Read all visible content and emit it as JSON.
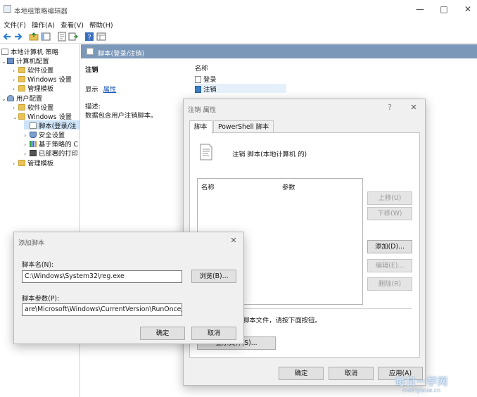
{
  "window": {
    "title": "本地组策略编辑器"
  },
  "menu": [
    "文件(F)",
    "操作(A)",
    "查看(V)",
    "帮助(H)"
  ],
  "tree": [
    {
      "label": "本地计算机 策略",
      "icon": "computer-policy-icon"
    },
    {
      "label": "计算机配置",
      "icon": "computer-icon"
    },
    {
      "label": "软件设置",
      "icon": "folder-icon"
    },
    {
      "label": "Windows 设置",
      "icon": "folder-icon"
    },
    {
      "label": "管理模板",
      "icon": "folder-icon"
    },
    {
      "label": "用户配置",
      "icon": "user-icon"
    },
    {
      "label": "软件设置",
      "icon": "folder-icon"
    },
    {
      "label": "Windows 设置",
      "icon": "folder-icon"
    },
    {
      "label": "脚本(登录/注",
      "icon": "script-icon"
    },
    {
      "label": "安全设置",
      "icon": "shield-icon"
    },
    {
      "label": "基于策略的 C",
      "icon": "chart-icon"
    },
    {
      "label": "已部署的打印",
      "icon": "printer-icon"
    },
    {
      "label": "管理模板",
      "icon": "folder-icon"
    }
  ],
  "right_pane": {
    "header": "脚本(登录/注销)",
    "section_title": "注销",
    "display_label": "显示",
    "properties_link": "属性",
    "description_label": "描述:",
    "description_text": "数据包含用户注销脚本。",
    "list_header": "名称",
    "list_items": [
      "登录",
      "注销"
    ]
  },
  "properties_dialog": {
    "title": "注销 属性",
    "help": "?",
    "close": "✕",
    "tabs": [
      "脚本",
      "PowerShell 脚本"
    ],
    "heading": "注销 脚本(本地计算机 的)",
    "col_name": "名称",
    "col_params": "参数",
    "btn_up": "上移(U)",
    "btn_down": "下移(W)",
    "btn_add": "添加(D)...",
    "btn_edit": "编辑(E)...",
    "btn_remove": "删除(R)",
    "footer_text": "组策略对象中的脚本文件，请按下面按钮。",
    "btn_show_files": "显示文件(S)...",
    "btn_ok": "确定",
    "btn_cancel": "取消",
    "btn_apply": "应用(A)"
  },
  "add_script_dialog": {
    "title": "添加脚本",
    "close": "✕",
    "name_label": "脚本名(N):",
    "name_value": "C:\\Windows\\System32\\reg.exe",
    "browse": "浏览(B)...",
    "params_label": "脚本参数(P):",
    "params_value": "are\\Microsoft\\Windows\\CurrentVersion\\RunOnce/va /f",
    "ok": "确定",
    "cancel": "取消"
  },
  "watermark": {
    "text": "每日一学网",
    "subtext": "meiriyixue.cn"
  },
  "colors": {
    "header": "#7b98b8",
    "selection": "#cde3f7",
    "link": "#1a56b5"
  }
}
